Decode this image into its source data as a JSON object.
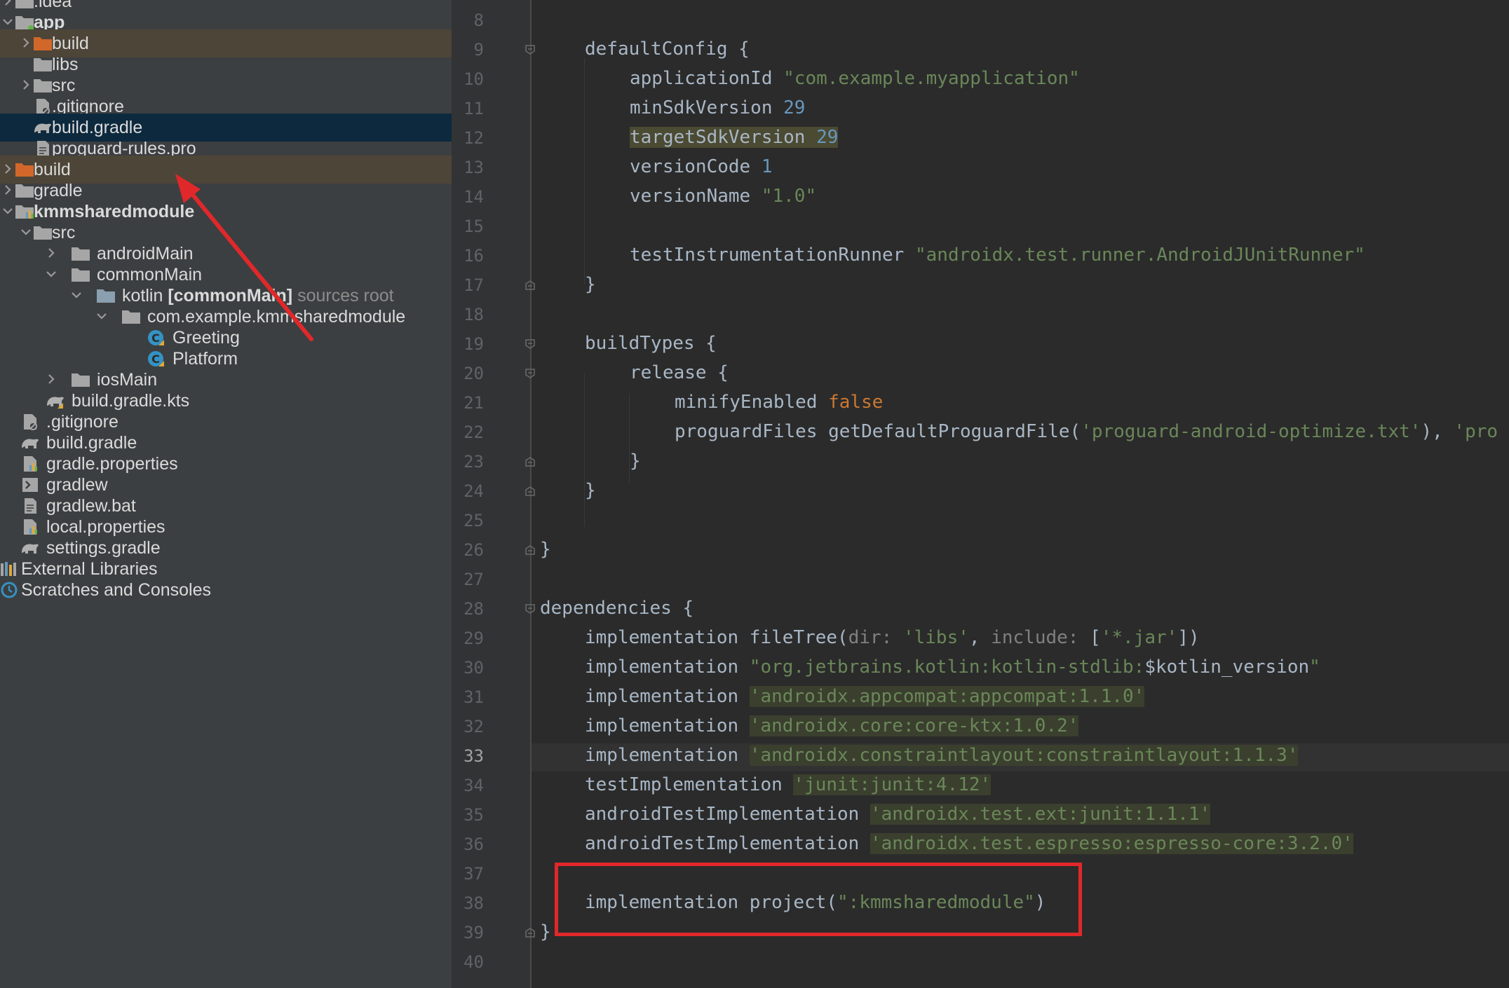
{
  "project_tree": {
    "items": [
      {
        "label": ".idea"
      },
      {
        "label": "app"
      },
      {
        "label": "build"
      },
      {
        "label": "libs"
      },
      {
        "label": "src"
      },
      {
        "label": ".gitignore"
      },
      {
        "label": "build.gradle"
      },
      {
        "label": "proguard-rules.pro"
      },
      {
        "label": "build"
      },
      {
        "label": "gradle"
      },
      {
        "label": "kmmsharedmodule"
      },
      {
        "label": "src"
      },
      {
        "label": "androidMain"
      },
      {
        "label": "commonMain"
      },
      {
        "label": "kotlin",
        "tag": "[commonMain]",
        "suffix": "sources root"
      },
      {
        "label": "com.example.kmmsharedmodule"
      },
      {
        "label": "Greeting"
      },
      {
        "label": "Platform"
      },
      {
        "label": "iosMain"
      },
      {
        "label": "build.gradle.kts"
      },
      {
        "label": ".gitignore"
      },
      {
        "label": "build.gradle"
      },
      {
        "label": "gradle.properties"
      },
      {
        "label": "gradlew"
      },
      {
        "label": "gradlew.bat"
      },
      {
        "label": "local.properties"
      },
      {
        "label": "settings.gradle"
      },
      {
        "label": "External Libraries"
      },
      {
        "label": "Scratches and Consoles"
      }
    ]
  },
  "editor": {
    "current_line": "33",
    "line_numbers": [
      "8",
      "9",
      "10",
      "11",
      "12",
      "13",
      "14",
      "15",
      "16",
      "17",
      "18",
      "19",
      "20",
      "21",
      "22",
      "23",
      "24",
      "25",
      "26",
      "27",
      "28",
      "29",
      "30",
      "31",
      "32",
      "33",
      "34",
      "35",
      "36",
      "37",
      "38",
      "39",
      "40"
    ],
    "code": {
      "l9": {
        "t1": "defaultConfig {"
      },
      "l10": {
        "t1": "applicationId ",
        "s1": "\"com.example.myapplication\""
      },
      "l11": {
        "t1": "minSdkVersion ",
        "n1": "29"
      },
      "l12": {
        "t1": "targetSdkVersion ",
        "n1": "29"
      },
      "l13": {
        "t1": "versionCode ",
        "n1": "1"
      },
      "l14": {
        "t1": "versionName ",
        "s1": "\"1.0\""
      },
      "l16": {
        "t1": "testInstrumentationRunner ",
        "s1": "\"androidx.test.runner.AndroidJUnitRunner\""
      },
      "l17": {
        "t1": "}"
      },
      "l19": {
        "t1": "buildTypes {"
      },
      "l20": {
        "t1": "release {"
      },
      "l21": {
        "t1": "minifyEnabled ",
        "k1": "false"
      },
      "l22": {
        "t1": "proguardFiles getDefaultProguardFile(",
        "s1": "'proguard-android-optimize.txt'",
        "t2": "), ",
        "s2": "'pro"
      },
      "l23": {
        "t1": "}"
      },
      "l24": {
        "t1": "}"
      },
      "l26": {
        "t1": "}"
      },
      "l28": {
        "t1": "dependencies {"
      },
      "l29": {
        "t1": "implementation fileTree(",
        "nm1": "dir: ",
        "s1": "'libs'",
        "t2": ", ",
        "nm2": "include: ",
        "t3": "[",
        "s2": "'*.jar'",
        "t4": "])"
      },
      "l30": {
        "t1": "implementation ",
        "s1": "\"org.jetbrains.kotlin:kotlin-stdlib:",
        "t2": "$kotlin_version",
        "s2": "\""
      },
      "l31": {
        "t1": "implementation ",
        "s1": "'androidx.appcompat:appcompat:1.1.0'"
      },
      "l32": {
        "t1": "implementation ",
        "s1": "'androidx.core:core-ktx:1.0.2'"
      },
      "l33": {
        "t1": "implementation ",
        "s1": "'androidx.constraintlayout:constraintlayout:1.1.3'"
      },
      "l34": {
        "t1": "testImplementation ",
        "s1": "'junit:junit:4.12'"
      },
      "l35": {
        "t1": "androidTestImplementation ",
        "s1": "'androidx.test.ext:junit:1.1.1'"
      },
      "l36": {
        "t1": "androidTestImplementation ",
        "s1": "'androidx.test.espresso:espresso-core:3.2.0'"
      },
      "l38": {
        "t1": "implementation project(",
        "s1": "\":kmmsharedmodule\"",
        "t2": ")"
      },
      "l39": {
        "t1": "}"
      }
    }
  },
  "colors": {
    "tree_bg": "#3c3f41",
    "editor_bg": "#2b2b2b",
    "selection": "#0d293e",
    "excluded_folder_row": "#4d4538",
    "string": "#6a8759",
    "number": "#6897bb",
    "keyword": "#cc7832",
    "annotation_red": "#e0282a"
  }
}
